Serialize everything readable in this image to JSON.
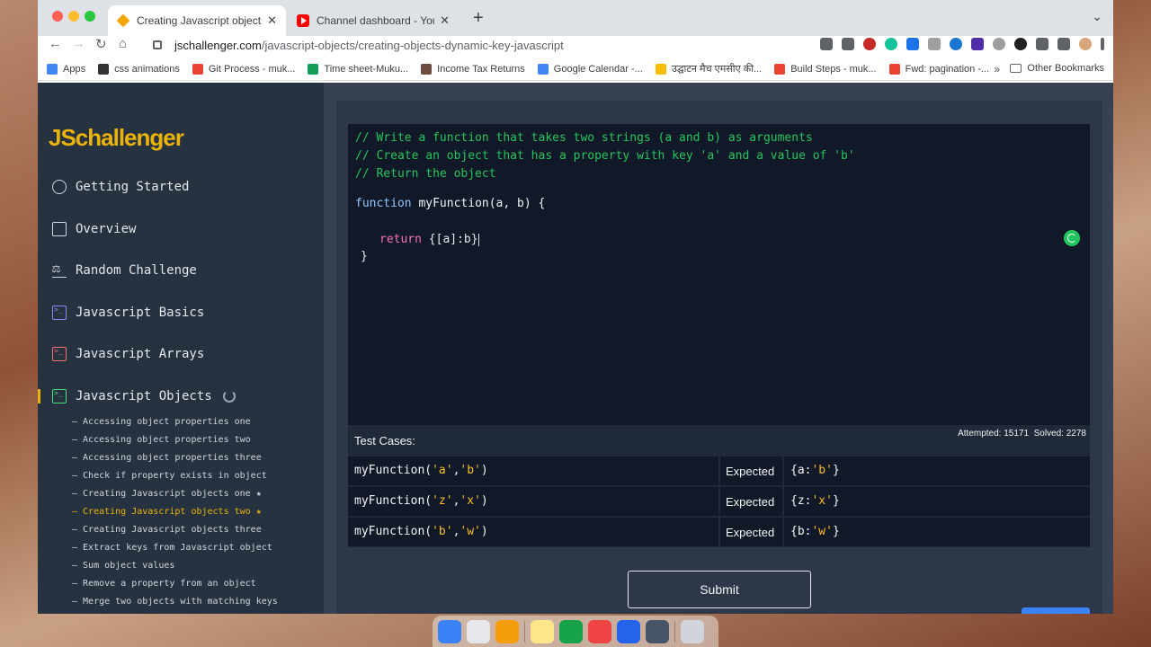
{
  "browser": {
    "tabs": [
      {
        "title": "Creating Javascript objects two",
        "active": true
      },
      {
        "title": "Channel dashboard - YouTube",
        "active": false
      }
    ],
    "url_domain": "jschallenger.com",
    "url_path": "/javascript-objects/creating-objects-dynamic-key-javascript",
    "bookmarks": [
      {
        "label": "Apps",
        "color": "#4285f4"
      },
      {
        "label": "css animations",
        "color": "#333333"
      },
      {
        "label": "Git Process - muk...",
        "color": "#ea4335"
      },
      {
        "label": "Time sheet-Muku...",
        "color": "#0f9d58"
      },
      {
        "label": "Income Tax Returns",
        "color": "#6d4c41"
      },
      {
        "label": "Google Calendar -...",
        "color": "#4285f4"
      },
      {
        "label": "उद्घाटन मैच एमसीए की...",
        "color": "#fbbc04"
      },
      {
        "label": "Build Steps - muk...",
        "color": "#ea4335"
      },
      {
        "label": "Fwd: pagination -...",
        "color": "#ea4335"
      }
    ],
    "more_bookmarks": "»",
    "other_bookmarks": "Other Bookmarks"
  },
  "sidebar": {
    "logo": "JSchallenger",
    "items": [
      {
        "label": "Getting Started",
        "icon": "question-circle-icon"
      },
      {
        "label": "Overview",
        "icon": "clipboard-icon"
      },
      {
        "label": "Random Challenge",
        "icon": "scale-icon"
      },
      {
        "label": "Javascript Basics",
        "icon": "terminal-icon",
        "color": "#818cf8"
      },
      {
        "label": "Javascript Arrays",
        "icon": "terminal-icon",
        "color": "#f87171"
      },
      {
        "label": "Javascript Objects",
        "icon": "terminal-icon",
        "color": "#4ade80"
      }
    ],
    "sub_items": [
      "– Accessing object properties one",
      "– Accessing object properties two",
      "– Accessing object properties three",
      "– Check if property exists in object",
      "– Creating Javascript objects one ★",
      "– Creating Javascript objects two ★",
      "– Creating Javascript objects three",
      "– Extract keys from Javascript object",
      "– Sum object values",
      "– Remove a property from an object",
      "– Merge two objects with matching keys"
    ]
  },
  "editor": {
    "comments": [
      "// Write a function that takes two strings (a and b) as arguments",
      "// Create an object that has a property with key 'a' and a value of 'b'",
      "// Return the object"
    ],
    "fn_keyword": "function",
    "fn_signature": " myFunction(a, b) {",
    "return_keyword": "return",
    "return_value": " {[a]:b}",
    "closing": "}"
  },
  "tests": {
    "label": "Test Cases:",
    "attempted": "Attempted: 15171",
    "solved": "Solved: 2278",
    "expected_label": "Expected",
    "rows": [
      {
        "fn": "myFunction(",
        "a1": "'a'",
        "comma": ",",
        "a2": "'b'",
        "end": ")",
        "exp_open": "{a:",
        "exp_val": "'b'",
        "exp_close": "}"
      },
      {
        "fn": "myFunction(",
        "a1": "'z'",
        "comma": ",",
        "a2": "'x'",
        "end": ")",
        "exp_open": "{z:",
        "exp_val": "'x'",
        "exp_close": "}"
      },
      {
        "fn": "myFunction(",
        "a1": "'b'",
        "comma": ",",
        "a2": "'w'",
        "end": ")",
        "exp_open": "{b:",
        "exp_val": "'w'",
        "exp_close": "}"
      }
    ]
  },
  "submit_label": "Submit",
  "dock": {
    "apps": [
      {
        "name": "finder-icon",
        "color": "#3b82f6"
      },
      {
        "name": "launchpad-icon",
        "color": "#e5e7eb"
      },
      {
        "name": "photos-icon",
        "color": "#f59e0b"
      },
      {
        "name": "notes-icon",
        "color": "#fde68a"
      },
      {
        "name": "excel-icon",
        "color": "#16a34a"
      },
      {
        "name": "chrome-icon",
        "color": "#ef4444"
      },
      {
        "name": "vscode-icon",
        "color": "#2563eb"
      },
      {
        "name": "quicktime-icon",
        "color": "#475569"
      },
      {
        "name": "trash-icon",
        "color": "#d1d5db"
      }
    ]
  }
}
